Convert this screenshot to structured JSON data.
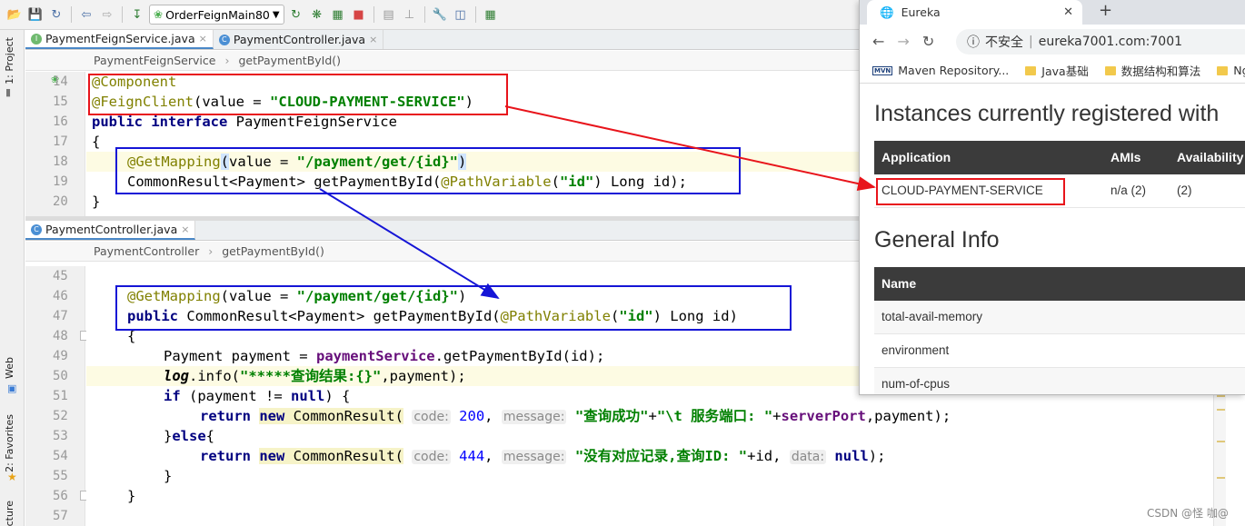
{
  "toolbar": {
    "run_config": "OrderFeignMain80"
  },
  "side_labels": {
    "project": "1: Project",
    "web": "Web",
    "favorites": "2: Favorites",
    "structure": "cture"
  },
  "top_editor": {
    "tabs": [
      {
        "label": "PaymentFeignService.java",
        "active": true
      },
      {
        "label": "PaymentController.java",
        "active": false
      }
    ],
    "breadcrumb": [
      "PaymentFeignService",
      "getPaymentById()"
    ],
    "line_numbers": [
      "14",
      "15",
      "16",
      "17",
      "18",
      "19",
      "20"
    ],
    "lines": {
      "l14": "@Component",
      "l15_anno": "@FeignClient",
      "l15_open": "(value = ",
      "l15_str": "\"CLOUD-PAYMENT-SERVICE\"",
      "l15_close": ")",
      "l16_kw": "public interface ",
      "l16_name": "PaymentFeignService",
      "l17": "{",
      "l18_anno": "@GetMapping",
      "l18_open": "(",
      "l18_mid": "value = ",
      "l18_str": "\"/payment/get/{id}\"",
      "l18_close": ")",
      "l19_a": "CommonResult<Payment> getPaymentById(",
      "l19_anno": "@PathVariable",
      "l19_b": "(",
      "l19_str": "\"id\"",
      "l19_c": ") Long id);",
      "l20": "}"
    }
  },
  "bottom_editor": {
    "tabs": [
      {
        "label": "PaymentController.java",
        "active": true
      }
    ],
    "breadcrumb": [
      "PaymentController",
      "getPaymentById()"
    ],
    "line_numbers": [
      "45",
      "46",
      "47",
      "48",
      "49",
      "50",
      "51",
      "52",
      "53",
      "54",
      "55",
      "56",
      "57"
    ],
    "lines": {
      "l46_anno": "@GetMapping",
      "l46_open": "(value = ",
      "l46_str": "\"/payment/get/{id}\"",
      "l46_close": ")",
      "l47_kw": "public ",
      "l47_a": "CommonResult<Payment> getPaymentById(",
      "l47_anno": "@PathVariable",
      "l47_b": "(",
      "l47_str": "\"id\"",
      "l47_c": ") Long id)",
      "l48": "{",
      "l49_a": "Payment payment = ",
      "l49_field": "paymentService",
      "l49_b": ".getPaymentById(id);",
      "l50_log": "log",
      "l50_a": ".info(",
      "l50_str": "\"*****查询结果:{}\"",
      "l50_b": ",payment);",
      "l51_kw": "if ",
      "l51_a": "(payment != ",
      "l51_null": "null",
      "l51_b": ") {",
      "l52_ret": "return ",
      "l52_new": "new ",
      "l52_a": "CommonResult(",
      "l52_hint1": "code:",
      "l52_num": "200",
      "l52_sep": ", ",
      "l52_hint2": "message:",
      "l52_str1": "\"查询成功\"",
      "l52_plus": "+",
      "l52_str2": "\"\\t 服务端口: \"",
      "l52_plus2": "+",
      "l52_field": "serverPort",
      "l52_end": ",payment);",
      "l53_a": "}",
      "l53_kw": "else",
      "l53_b": "{",
      "l54_ret": "return ",
      "l54_new": "new ",
      "l54_a": "CommonResult(",
      "l54_hint1": "code:",
      "l54_num": "444",
      "l54_sep": ", ",
      "l54_hint2": "message:",
      "l54_str": "\"没有对应记录,查询ID: \"",
      "l54_mid": "+id, ",
      "l54_hint3": "data:",
      "l54_null": "null",
      "l54_end": ");",
      "l55": "}",
      "l56": "}"
    }
  },
  "browser": {
    "tab_title": "Eureka",
    "insecure_label": "不安全",
    "url": "eureka7001.com:7001",
    "bookmarks": [
      "Maven Repository...",
      "Java基础",
      "数据结构和算法",
      "Ng"
    ],
    "heading_instances": "Instances currently registered with",
    "instances_headers": [
      "Application",
      "AMIs",
      "Availability"
    ],
    "instance_row": {
      "application": "CLOUD-PAYMENT-SERVICE",
      "amis": "n/a (2)",
      "availability": "(2)"
    },
    "heading_general": "General Info",
    "general_header": "Name",
    "general_rows": [
      "total-avail-memory",
      "environment",
      "num-of-cpus"
    ]
  },
  "watermark": "CSDN @怪 咖@",
  "colors": {
    "red_annotation": "#e8141b",
    "blue_annotation": "#1515d6"
  }
}
